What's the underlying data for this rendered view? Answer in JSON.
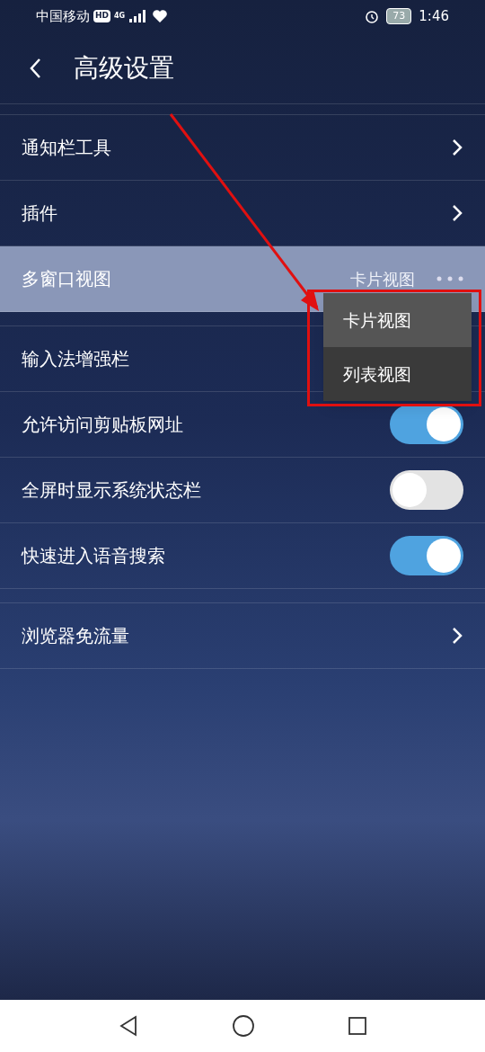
{
  "status_bar": {
    "carrier": "中国移动",
    "hd": "HD",
    "network": "4G",
    "battery": "73",
    "time": "1:46"
  },
  "header": {
    "title": "高级设置"
  },
  "groups": [
    {
      "items": [
        {
          "kind": "link",
          "label": "通知栏工具"
        },
        {
          "kind": "link",
          "label": "插件"
        },
        {
          "kind": "menu",
          "label": "多窗口视图",
          "value": "卡片视图",
          "highlighted": true
        }
      ]
    },
    {
      "items": [
        {
          "kind": "plain",
          "label": "输入法增强栏"
        },
        {
          "kind": "toggle",
          "label": "允许访问剪贴板网址",
          "on": true
        },
        {
          "kind": "toggle",
          "label": "全屏时显示系统状态栏",
          "on": false
        },
        {
          "kind": "toggle",
          "label": "快速进入语音搜索",
          "on": true
        }
      ]
    },
    {
      "items": [
        {
          "kind": "link",
          "label": "浏览器免流量"
        }
      ]
    }
  ],
  "popup_menu": [
    {
      "label": "卡片视图",
      "selected": true
    },
    {
      "label": "列表视图",
      "selected": false
    }
  ]
}
